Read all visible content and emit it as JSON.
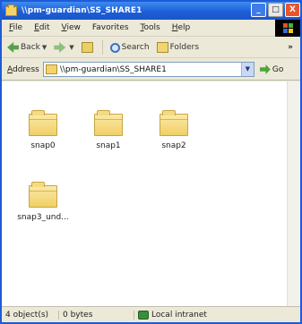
{
  "window": {
    "title": "\\\\pm-guardian\\SS_SHARE1",
    "minimize_label": "_",
    "maximize_label": "□",
    "close_label": "X"
  },
  "menu": {
    "items": [
      {
        "ul": "F",
        "rest": "ile"
      },
      {
        "ul": "E",
        "rest": "dit"
      },
      {
        "ul": "V",
        "rest": "iew"
      },
      {
        "ul": "",
        "rest": "Favorites"
      },
      {
        "ul": "T",
        "rest": "ools"
      },
      {
        "ul": "H",
        "rest": "elp"
      }
    ]
  },
  "toolbar": {
    "back_label": "Back",
    "search_label": "Search",
    "folders_label": "Folders",
    "more_label": "»"
  },
  "address": {
    "label_ul": "A",
    "label_rest": "ddress",
    "value": "\\\\pm-guardian\\SS_SHARE1",
    "go_label": "Go"
  },
  "folders": [
    {
      "name": "snap0"
    },
    {
      "name": "snap1"
    },
    {
      "name": "snap2"
    },
    {
      "name": "snap3_und..."
    }
  ],
  "status": {
    "objects": "4 object(s)",
    "size": "0 bytes",
    "zone": "Local intranet"
  },
  "colors": {
    "titlebar": "#1d5fd8",
    "chrome": "#ece9d8",
    "folder": "#f0cf66"
  }
}
